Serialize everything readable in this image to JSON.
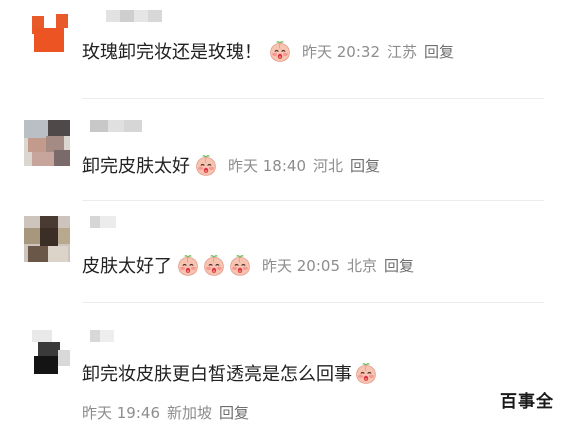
{
  "comments": [
    {
      "text": "玫瑰卸完妆还是玫瑰！",
      "emoji_count": 1,
      "time": "昨天 20:32",
      "location": "江苏",
      "reply": "回复"
    },
    {
      "text": "卸完皮肤太好",
      "emoji_count": 1,
      "time": "昨天 18:40",
      "location": "河北",
      "reply": "回复"
    },
    {
      "text": "皮肤太好了",
      "emoji_count": 3,
      "time": "昨天 20:05",
      "location": "北京",
      "reply": "回复"
    },
    {
      "text": "卸完妆皮肤更白皙透亮是怎么回事",
      "emoji_count": 1,
      "time": "昨天 19:46",
      "location": "新加坡",
      "reply": "回复"
    }
  ],
  "emoji_icon": "blushing-peach-face-icon",
  "watermark": "百事全"
}
